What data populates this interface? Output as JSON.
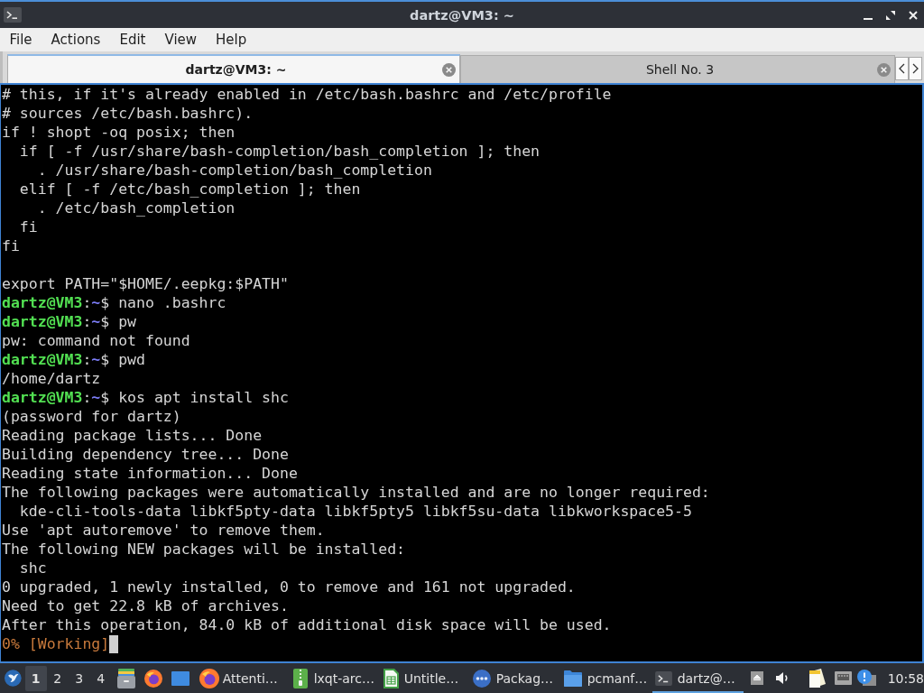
{
  "window": {
    "title": "dartz@VM3: ~"
  },
  "menu_bar": [
    "File",
    "Actions",
    "Edit",
    "View",
    "Help"
  ],
  "tabs": [
    {
      "label": "dartz@VM3: ~",
      "selected": true
    },
    {
      "label": "Shell No. 3",
      "selected": false
    }
  ],
  "terminal": {
    "lines": [
      {
        "kind": "text",
        "text": "# this, if it's already enabled in /etc/bash.bashrc and /etc/profile"
      },
      {
        "kind": "text",
        "text": "# sources /etc/bash.bashrc)."
      },
      {
        "kind": "text",
        "text": "if ! shopt -oq posix; then"
      },
      {
        "kind": "text",
        "text": "  if [ -f /usr/share/bash-completion/bash_completion ]; then"
      },
      {
        "kind": "text",
        "text": "    . /usr/share/bash-completion/bash_completion"
      },
      {
        "kind": "text",
        "text": "  elif [ -f /etc/bash_completion ]; then"
      },
      {
        "kind": "text",
        "text": "    . /etc/bash_completion"
      },
      {
        "kind": "text",
        "text": "  fi"
      },
      {
        "kind": "text",
        "text": "fi"
      },
      {
        "kind": "blank"
      },
      {
        "kind": "text",
        "text": "export PATH=\"$HOME/.eepkg:$PATH\""
      },
      {
        "kind": "prompt",
        "user": "dartz@VM3",
        "colon": ":",
        "path": "~",
        "sign": "$",
        "command": "nano .bashrc"
      },
      {
        "kind": "prompt",
        "user": "dartz@VM3",
        "colon": ":",
        "path": "~",
        "sign": "$",
        "command": "pw"
      },
      {
        "kind": "text",
        "text": "pw: command not found"
      },
      {
        "kind": "prompt",
        "user": "dartz@VM3",
        "colon": ":",
        "path": "~",
        "sign": "$",
        "command": "pwd"
      },
      {
        "kind": "text",
        "text": "/home/dartz"
      },
      {
        "kind": "prompt",
        "user": "dartz@VM3",
        "colon": ":",
        "path": "~",
        "sign": "$",
        "command": "kos apt install shc"
      },
      {
        "kind": "text",
        "text": "(password for dartz)"
      },
      {
        "kind": "text",
        "text": "Reading package lists... Done"
      },
      {
        "kind": "text",
        "text": "Building dependency tree... Done"
      },
      {
        "kind": "text",
        "text": "Reading state information... Done"
      },
      {
        "kind": "text",
        "text": "The following packages were automatically installed and are no longer required:"
      },
      {
        "kind": "text",
        "text": "  kde-cli-tools-data libkf5pty-data libkf5pty5 libkf5su-data libkworkspace5-5"
      },
      {
        "kind": "text",
        "text": "Use 'apt autoremove' to remove them."
      },
      {
        "kind": "text",
        "text": "The following NEW packages will be installed:"
      },
      {
        "kind": "text",
        "text": "  shc"
      },
      {
        "kind": "text",
        "text": "0 upgraded, 1 newly installed, 0 to remove and 161 not upgraded."
      },
      {
        "kind": "text",
        "text": "Need to get 22.8 kB of archives."
      },
      {
        "kind": "text",
        "text": "After this operation, 84.0 kB of additional disk space will be used."
      },
      {
        "kind": "progress",
        "text": "0% [Working]",
        "cursor": true
      }
    ]
  },
  "taskbar": {
    "desktops": [
      {
        "label": "1",
        "selected": true
      },
      {
        "label": "2",
        "selected": false
      },
      {
        "label": "3",
        "selected": false
      },
      {
        "label": "4",
        "selected": false
      }
    ],
    "tasks": [
      {
        "kind": "browser",
        "label": "Attenti…",
        "selected": false
      },
      {
        "kind": "archive",
        "label": "lxqt-arc…",
        "selected": false
      },
      {
        "kind": "spreadsheet",
        "label": "Untitle…",
        "selected": false
      },
      {
        "kind": "package",
        "label": "Packag…",
        "selected": false
      },
      {
        "kind": "folder",
        "label": "pcmanf…",
        "selected": false
      },
      {
        "kind": "terminal",
        "label": "dartz@…",
        "selected": true
      }
    ],
    "clock": "10:58"
  }
}
